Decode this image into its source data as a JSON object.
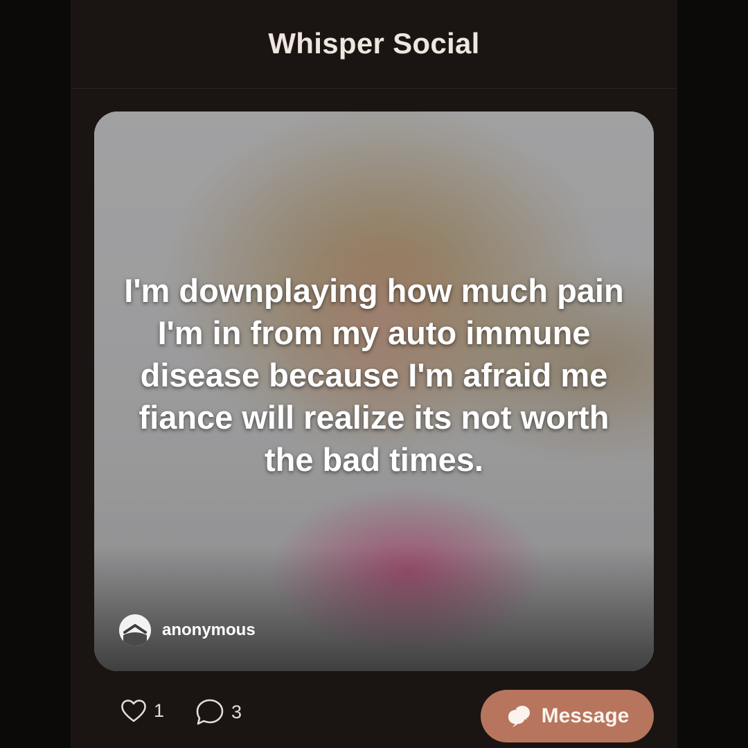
{
  "header": {
    "title": "Whisper Social"
  },
  "post": {
    "text": "I'm downplaying how much pain I'm in from my auto immune disease because I'm afraid me fiance will realize its not worth the bad times.",
    "author": "anonymous"
  },
  "actions": {
    "like_count": "1",
    "comment_count": "3",
    "message_label": "Message"
  },
  "icons": {
    "like": "heart-outline-icon",
    "comment": "speech-bubble-outline-icon",
    "message": "chat-bubbles-icon",
    "avatar": "anonymous-avatar-icon"
  },
  "colors": {
    "background": "#1a1512",
    "title": "#efe6df",
    "accent_button": "#b7755d"
  }
}
